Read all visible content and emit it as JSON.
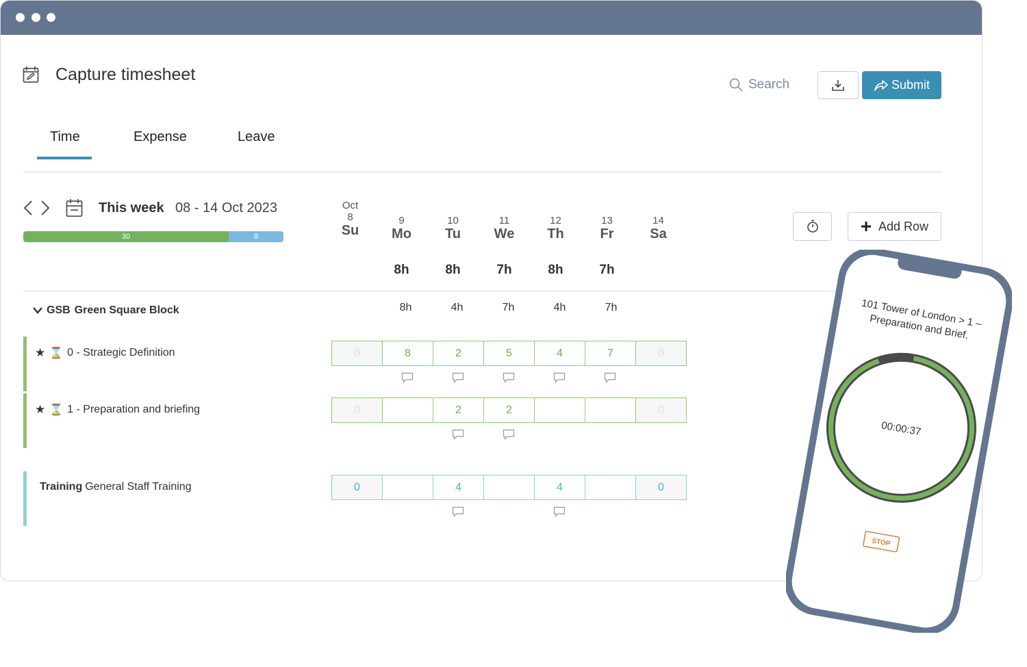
{
  "header": {
    "title": "Capture timesheet",
    "search_placeholder": "Search",
    "submit_label": "Submit"
  },
  "tabs": [
    {
      "label": "Time",
      "active": true
    },
    {
      "label": "Expense"
    },
    {
      "label": "Leave"
    }
  ],
  "week": {
    "label": "This week",
    "range": "08 - 14 Oct 2023",
    "hours_green": "30",
    "hours_blue": "8"
  },
  "days": [
    {
      "month": "Oct",
      "num": "8",
      "name": "Su",
      "total": "",
      "group_total": ""
    },
    {
      "month": "",
      "num": "9",
      "name": "Mo",
      "total": "8h",
      "group_total": "8h"
    },
    {
      "month": "",
      "num": "10",
      "name": "Tu",
      "total": "8h",
      "group_total": "4h"
    },
    {
      "month": "",
      "num": "11",
      "name": "We",
      "total": "7h",
      "group_total": "7h"
    },
    {
      "month": "",
      "num": "12",
      "name": "Th",
      "total": "8h",
      "group_total": "4h"
    },
    {
      "month": "",
      "num": "13",
      "name": "Fr",
      "total": "7h",
      "group_total": "7h"
    },
    {
      "month": "",
      "num": "14",
      "name": "Sa",
      "total": "",
      "group_total": ""
    }
  ],
  "actions": {
    "add_row_label": "Add Row"
  },
  "group": {
    "code": "GSB",
    "name": "Green Square Block"
  },
  "rows": [
    {
      "label": "0 - Strategic Definition",
      "values": [
        "0",
        "8",
        "2",
        "5",
        "4",
        "7",
        "0"
      ]
    },
    {
      "label": "1 - Preparation and briefing",
      "values": [
        "0",
        "",
        "2",
        "2",
        "",
        "",
        "0"
      ]
    }
  ],
  "training": {
    "bold": "Training",
    "label": "General Staff Training",
    "values": [
      "0",
      "",
      "4",
      "",
      "4",
      "",
      "0"
    ]
  },
  "phone": {
    "line1": "101 Tower of London > 1 –",
    "line2": "Preparation and Brief.",
    "timer": "00:00:37",
    "stop_label": "STOP",
    "progress": 0.92
  },
  "colors": {
    "titlebar": "#63758f",
    "accent": "#3b8fb3",
    "green": "#76b15d",
    "blue": "#7bb9df",
    "teal": "#8fcfd5",
    "stop": "#e07b39"
  }
}
